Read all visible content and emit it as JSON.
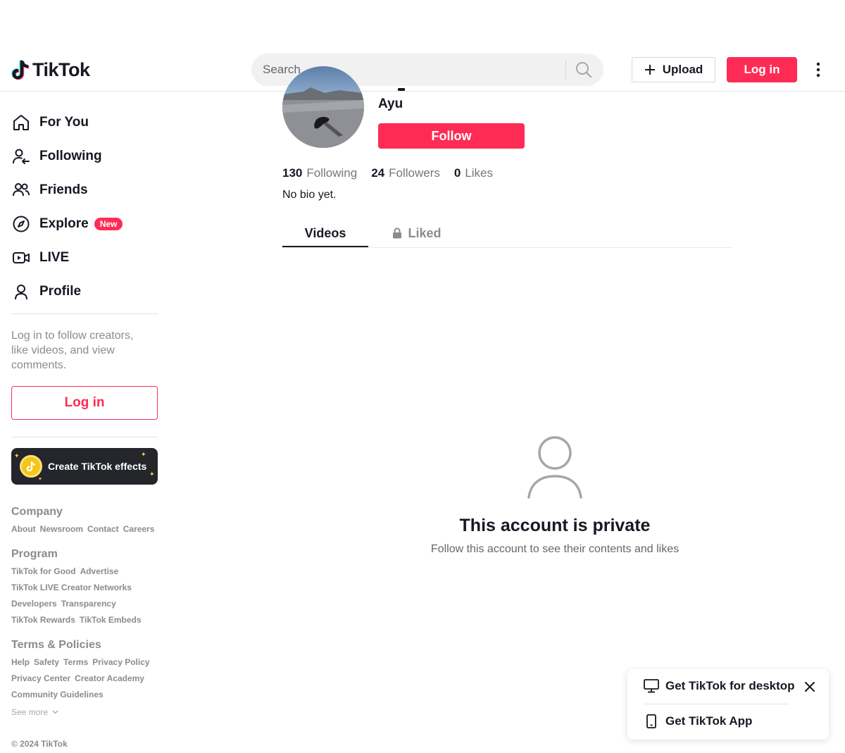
{
  "header": {
    "logo_text": "TikTok",
    "search_placeholder": "Search",
    "upload_label": "Upload",
    "login_label": "Log in"
  },
  "sidebar": {
    "nav": [
      {
        "label": "For You",
        "icon": "home-icon"
      },
      {
        "label": "Following",
        "icon": "following-icon"
      },
      {
        "label": "Friends",
        "icon": "friends-icon"
      },
      {
        "label": "Explore",
        "icon": "compass-icon",
        "badge": "New"
      },
      {
        "label": "LIVE",
        "icon": "live-icon"
      },
      {
        "label": "Profile",
        "icon": "profile-icon"
      }
    ],
    "login_prompt": "Log in to follow creators, like videos, and view comments.",
    "login_button": "Log in",
    "effects_button": "Create TikTok effects",
    "footer": {
      "company_heading": "Company",
      "company_links": [
        "About",
        "Newsroom",
        "Contact",
        "Careers"
      ],
      "program_heading": "Program",
      "program_lines": [
        [
          "TikTok for Good",
          "Advertise"
        ],
        [
          "TikTok LIVE Creator Networks"
        ],
        [
          "Developers",
          "Transparency"
        ],
        [
          "TikTok Rewards",
          "TikTok Embeds"
        ]
      ],
      "terms_heading": "Terms & Policies",
      "terms_lines": [
        [
          "Help",
          "Safety",
          "Terms",
          "Privacy Policy"
        ],
        [
          "Privacy Center",
          "Creator Academy"
        ],
        [
          "Community Guidelines"
        ]
      ],
      "see_more": "See more",
      "copyright": "© 2024 TikTok"
    }
  },
  "profile": {
    "nickname": "Ayu",
    "follow_label": "Follow",
    "stats": [
      {
        "value": "130",
        "label": "Following"
      },
      {
        "value": "24",
        "label": "Followers"
      },
      {
        "value": "0",
        "label": "Likes"
      }
    ],
    "bio": "No bio yet.",
    "tabs": [
      {
        "label": "Videos",
        "active": true
      },
      {
        "label": "Liked",
        "locked": true
      }
    ],
    "private_title": "This account is private",
    "private_subtitle": "Follow this account to see their contents and likes"
  },
  "download_card": {
    "desktop_label": "Get TikTok for desktop",
    "app_label": "Get TikTok App"
  },
  "colors": {
    "accent": "#fe2c55",
    "text": "#161823",
    "muted": "#8a8b91",
    "effects_bg": "#25262b"
  }
}
